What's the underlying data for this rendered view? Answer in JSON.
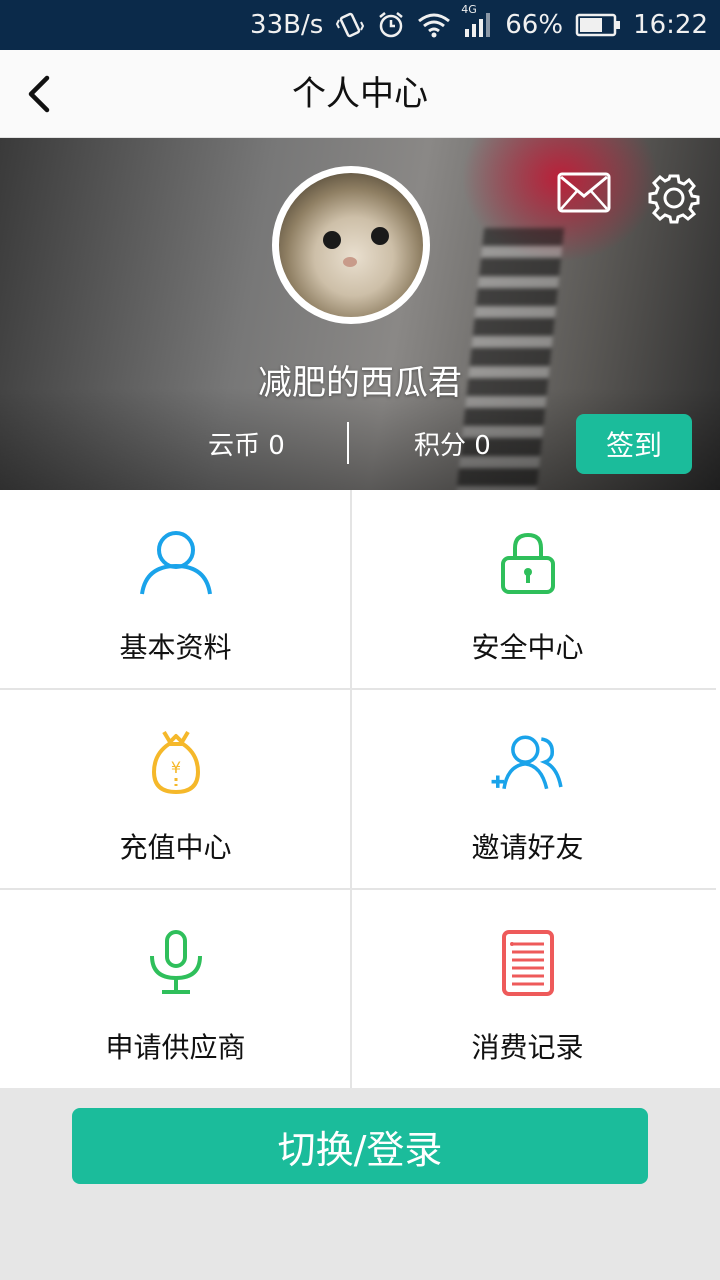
{
  "status_bar": {
    "net_speed": "33B/s",
    "network_type": "4G",
    "battery": "66%",
    "time": "16:22",
    "icons": [
      "vibrate-icon",
      "alarm-icon",
      "wifi-icon",
      "signal-icon",
      "battery-icon"
    ]
  },
  "header": {
    "title": "个人中心",
    "back_icon": "chevron-left-icon"
  },
  "profile": {
    "username": "减肥的西瓜君",
    "coins_label": "云币 0",
    "points_label": "积分 0",
    "checkin_label": "签到",
    "mail_icon": "mail-icon",
    "settings_icon": "gear-icon",
    "avatar": "cat-photo"
  },
  "menu": [
    {
      "label": "基本资料",
      "icon": "user-icon",
      "color": "#1aa3ea"
    },
    {
      "label": "安全中心",
      "icon": "lock-icon",
      "color": "#2fbf5b"
    },
    {
      "label": "充值中心",
      "icon": "money-bag-icon",
      "color": "#f5b82a"
    },
    {
      "label": "邀请好友",
      "icon": "add-friends-icon",
      "color": "#1aa3ea"
    },
    {
      "label": "申请供应商",
      "icon": "microphone-icon",
      "color": "#2fbf5b"
    },
    {
      "label": "消费记录",
      "icon": "records-icon",
      "color": "#ee5a5a"
    }
  ],
  "actions": {
    "switch_login_label": "切换/登录"
  },
  "colors": {
    "accent": "#1bbc9b",
    "status_bar": "#0b2a4a",
    "header_bg": "#fafafa",
    "page_bg": "#e6e6e6"
  }
}
